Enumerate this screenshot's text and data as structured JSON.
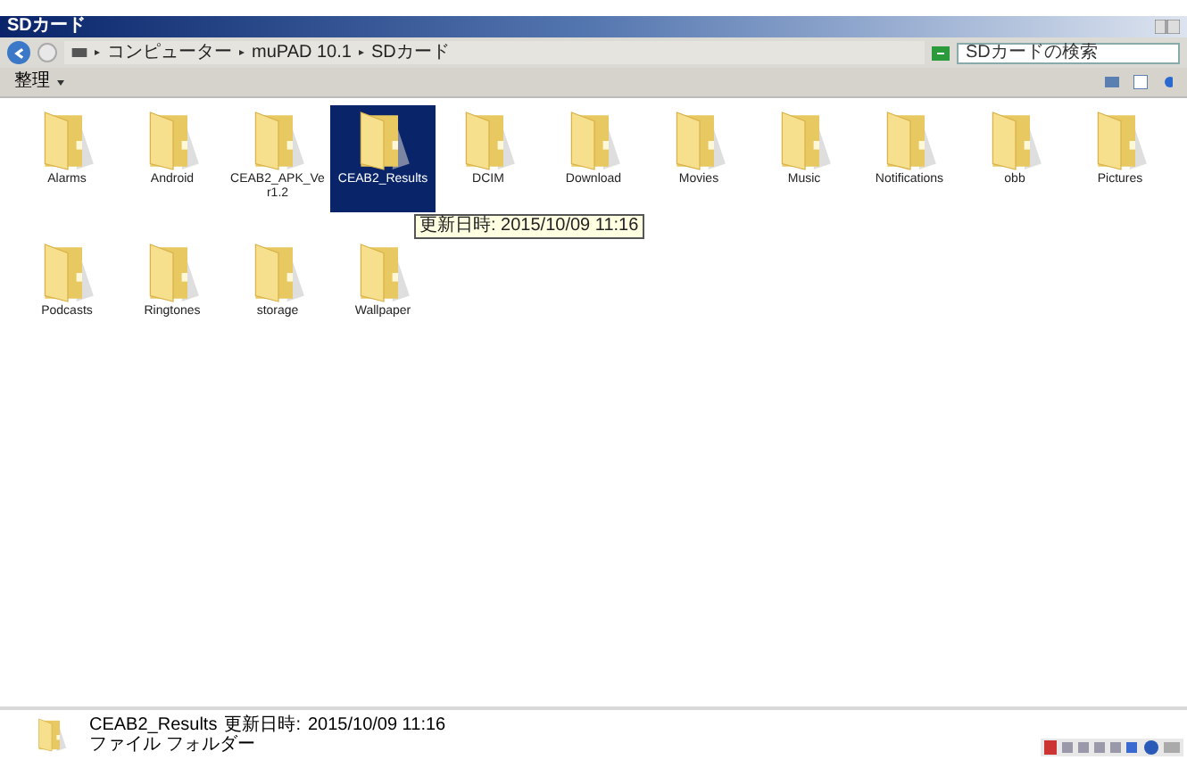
{
  "window": {
    "title": "SDカード"
  },
  "address": {
    "crumbs": [
      "コンピューター",
      "muPAD 10.1",
      "SDカード"
    ]
  },
  "search": {
    "placeholder": "SDカードの検索"
  },
  "toolbar": {
    "organize": "整理"
  },
  "folders": [
    {
      "name": "Alarms",
      "selected": false
    },
    {
      "name": "Android",
      "selected": false
    },
    {
      "name": "CEAB2_APK_Ver1.2",
      "selected": false
    },
    {
      "name": "CEAB2_Results",
      "selected": true
    },
    {
      "name": "DCIM",
      "selected": false
    },
    {
      "name": "Download",
      "selected": false
    },
    {
      "name": "Movies",
      "selected": false
    },
    {
      "name": "Music",
      "selected": false
    },
    {
      "name": "Notifications",
      "selected": false
    },
    {
      "name": "obb",
      "selected": false
    },
    {
      "name": "Pictures",
      "selected": false
    },
    {
      "name": "Podcasts",
      "selected": false
    },
    {
      "name": "Ringtones",
      "selected": false
    },
    {
      "name": "storage",
      "selected": false
    },
    {
      "name": "Wallpaper",
      "selected": false
    }
  ],
  "tooltip": "更新日時: 2015/10/09 11:16",
  "details": {
    "name": "CEAB2_Results",
    "modified_label": "更新日時:",
    "modified": "2015/10/09 11:16",
    "type": "ファイル フォルダー"
  }
}
